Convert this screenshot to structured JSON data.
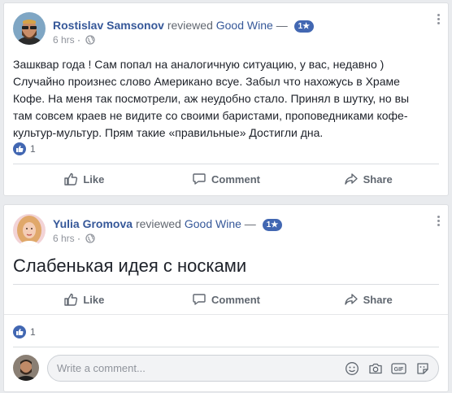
{
  "posts": [
    {
      "author": "Rostislav Samsonov",
      "verb": "reviewed",
      "page": "Good Wine",
      "dash": "—",
      "badge": "1★",
      "time": "6 hrs",
      "text_lines": [
        "Зашквар года ! Сам попал на аналогичную ситуацию, у вас, недавно )",
        "Случайно произнес слово Американо всуе. Забыл что нахожусь в Храме",
        "Кофе. На меня так посмотрели, аж неудобно стало. Принял в шутку, но вы",
        "там совсем краев не видите со своими баристами, проповедниками кофе-",
        "культур-мультур. Прям такие «правильные» Достигли дна."
      ],
      "like_count": "1"
    },
    {
      "author": "Yulia Gromova",
      "verb": "reviewed",
      "page": "Good Wine",
      "dash": "—",
      "badge": "1★",
      "time": "6 hrs",
      "text": "Слабенькая идея с носками",
      "like_count": "1"
    }
  ],
  "actions": {
    "like": "Like",
    "comment": "Comment",
    "share": "Share"
  },
  "comment_box": {
    "placeholder": "Write a comment..."
  },
  "icons": {
    "privacy": "globe-icon",
    "more": "more-options-icon",
    "like": "thumbs-up-icon",
    "comment": "speech-bubble-icon",
    "share": "share-arrow-icon",
    "emoji": "smiley-icon",
    "camera": "camera-icon",
    "gif": "gif-icon",
    "sticker": "sticker-icon"
  },
  "colors": {
    "link_blue": "#365899",
    "accent": "#4267b2",
    "muted": "#90949c"
  }
}
